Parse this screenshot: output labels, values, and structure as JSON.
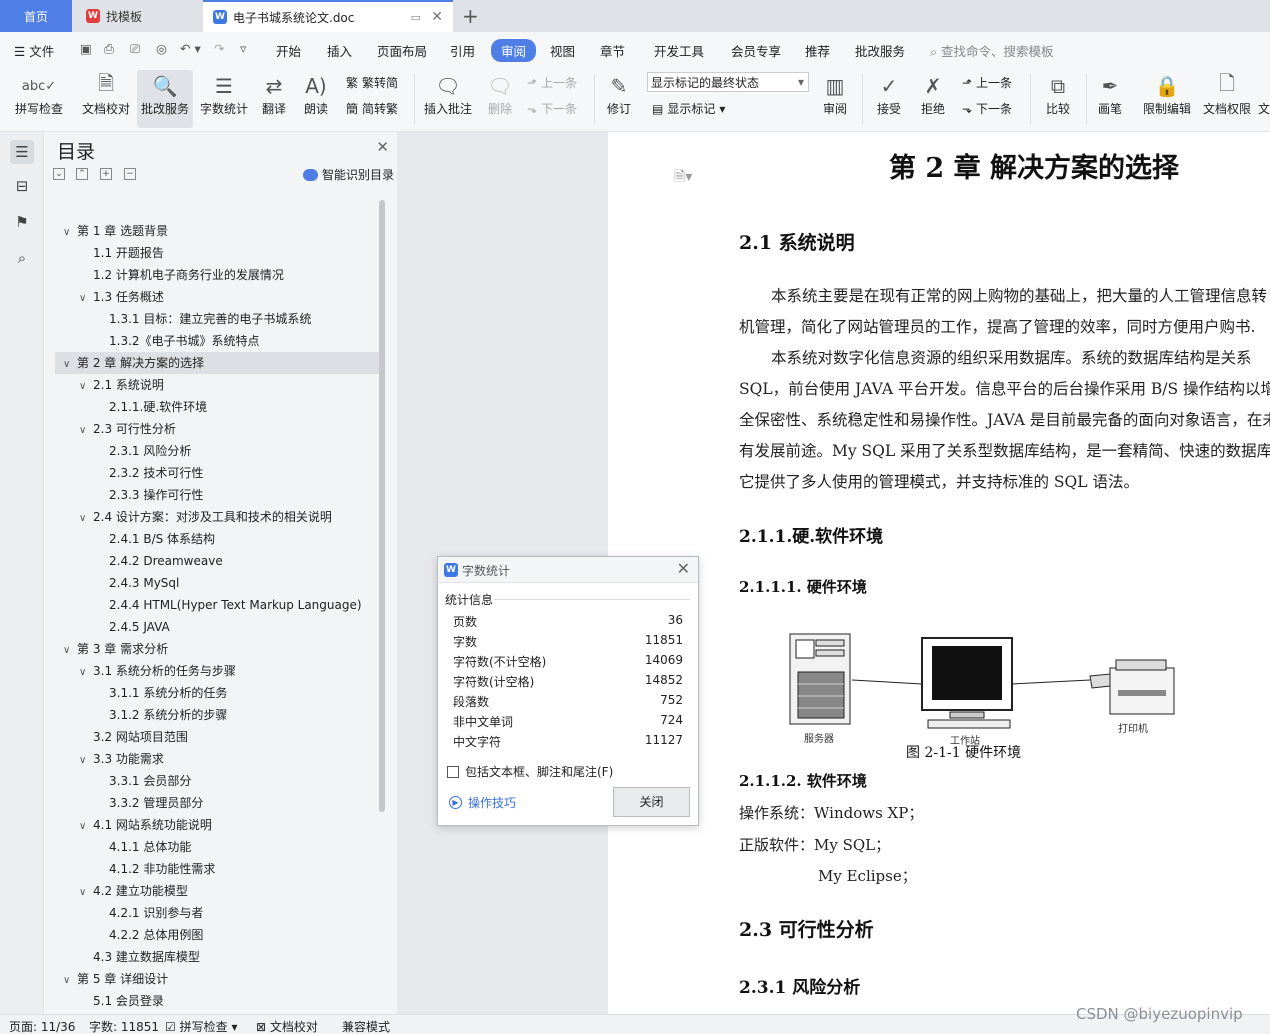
{
  "tabs": {
    "home": "首页",
    "template": "找模板",
    "document": "电子书城系统论文.doc"
  },
  "menubar": {
    "file": "文件",
    "items": [
      "开始",
      "插入",
      "页面布局",
      "引用",
      "审阅",
      "视图",
      "章节",
      "开发工具",
      "会员专享",
      "推荐",
      "批改服务"
    ],
    "active": "审阅",
    "search_placeholder": "查找命令、搜索模板"
  },
  "ribbon": {
    "spell": "拼写检查",
    "proof": "文档校对",
    "review_service": "批改服务",
    "wordcount": "字数统计",
    "translate": "翻译",
    "read": "朗读",
    "trad": "繁转简",
    "simp": "简转繁",
    "insert_comment": "插入批注",
    "delete": "删除",
    "prev": "上一条",
    "next": "下一条",
    "track": "修订",
    "markup_state": "显示标记的最终状态",
    "show_markup": "显示标记",
    "review": "审阅",
    "accept": "接受",
    "reject": "拒绝",
    "prev2": "上一条",
    "next2": "下一条",
    "compare": "比较",
    "pen": "画笔",
    "restrict": "限制编辑",
    "permission": "文档权限",
    "cut": "文"
  },
  "toc": {
    "title": "目录",
    "smart": "智能识别目录",
    "items": [
      {
        "label": "第 1 章  选题背景",
        "level": 0,
        "caret": true
      },
      {
        "label": "1.1 开题报告",
        "level": 1,
        "caret": false
      },
      {
        "label": "1.2 计算机电子商务行业的发展情况",
        "level": 1,
        "caret": false
      },
      {
        "label": "1.3  任务概述",
        "level": 1,
        "caret": true
      },
      {
        "label": "1.3.1 目标：建立完善的电子书城系统",
        "level": 2,
        "caret": false
      },
      {
        "label": "1.3.2《电子书城》系统特点",
        "level": 2,
        "caret": false
      },
      {
        "label": "第 2 章  解决方案的选择",
        "level": 0,
        "caret": true,
        "active": true
      },
      {
        "label": "2.1  系统说明",
        "level": 1,
        "caret": true
      },
      {
        "label": "2.1.1.硬.软件环境",
        "level": 2,
        "caret": false
      },
      {
        "label": "2.3 可行性分析",
        "level": 1,
        "caret": true
      },
      {
        "label": "2.3.1  风险分析",
        "level": 2,
        "caret": false
      },
      {
        "label": "2.3.2  技术可行性",
        "level": 2,
        "caret": false
      },
      {
        "label": "2.3.3  操作可行性",
        "level": 2,
        "caret": false
      },
      {
        "label": "2.4  设计方案：对涉及工具和技术的相关说明",
        "level": 1,
        "caret": true
      },
      {
        "label": "2.4.1 B/S 体系结构",
        "level": 2,
        "caret": false
      },
      {
        "label": "2.4.2 Dreamweave",
        "level": 2,
        "caret": false
      },
      {
        "label": "2.4.3 MySql",
        "level": 2,
        "caret": false
      },
      {
        "label": "2.4.4 HTML(Hyper Text Markup Language)",
        "level": 2,
        "caret": false
      },
      {
        "label": "2.4.5 JAVA",
        "level": 2,
        "caret": false
      },
      {
        "label": "第 3 章  需求分析",
        "level": 0,
        "caret": true
      },
      {
        "label": "3.1 系统分析的任务与步骤",
        "level": 1,
        "caret": true
      },
      {
        "label": "3.1.1  系统分析的任务",
        "level": 2,
        "caret": false
      },
      {
        "label": "3.1.2  系统分析的步骤",
        "level": 2,
        "caret": false
      },
      {
        "label": "3.2 网站项目范围",
        "level": 1,
        "caret": false
      },
      {
        "label": "3.3  功能需求",
        "level": 1,
        "caret": true
      },
      {
        "label": "3.3.1  会员部分",
        "level": 2,
        "caret": false
      },
      {
        "label": "3.3.2  管理员部分",
        "level": 2,
        "caret": false
      },
      {
        "label": "4.1  网站系统功能说明",
        "level": 1,
        "caret": true
      },
      {
        "label": "4.1.1 总体功能",
        "level": 2,
        "caret": false
      },
      {
        "label": "4.1.2 非功能性需求",
        "level": 2,
        "caret": false
      },
      {
        "label": "4.2  建立功能模型",
        "level": 1,
        "caret": true
      },
      {
        "label": "4.2.1 识别参与者",
        "level": 2,
        "caret": false
      },
      {
        "label": "4.2.2 总体用例图",
        "level": 2,
        "caret": false
      },
      {
        "label": "4.3  建立数据库模型",
        "level": 1,
        "caret": false
      },
      {
        "label": "第 5 章  详细设计",
        "level": 0,
        "caret": true
      },
      {
        "label": "5.1  会员登录",
        "level": 1,
        "caret": false
      }
    ]
  },
  "doc": {
    "h1": "第 2 章  解决方案的选择",
    "h2_1": "2.1  系统说明",
    "p1a": "本系统主要是在现有正常的网上购物的基础上，把大量的人工管理信息转",
    "p1b": "机管理，简化了网站管理员的工作，提高了管理的效率，同时方便用户购书.",
    "p2a": "本系统对数字化信息资源的组织采用数据库。系统的数据库结构是关系",
    "p2b": "SQL，前台使用 JAVA 平台开发。信息平台的后台操作采用 B/S 操作结构以增强",
    "p2c": "全保密性、系统稳定性和易操作性。JAVA 是目前最完备的面向对象语言，在未",
    "p2d": "有发展前途。My SQL 采用了关系型数据库结构，是一套精简、快速的数据库",
    "p2e": "它提供了多人使用的管理模式，并支持标准的 SQL 语法。",
    "h3_1": "2.1.1.硬.软件环境",
    "h4_1": "2.1.1.1.  硬件环境",
    "fig_server": "服务器",
    "fig_ws": "工作站",
    "fig_printer": "打印机",
    "fig_caption": "图 2-1-1  硬件环境",
    "h4_2": "2.1.1.2.  软件环境",
    "os": "操作系统：Windows XP；",
    "sw1": "正版软件：My SQL；",
    "sw2": "My Eclipse；",
    "h2_3": "2.3 可行性分析",
    "h3_31": "2.3.1  风险分析"
  },
  "dialog": {
    "title": "字数统计",
    "section": "统计信息",
    "rows": [
      {
        "label": "页数",
        "value": "36"
      },
      {
        "label": "字数",
        "value": "11851"
      },
      {
        "label": "字符数(不计空格)",
        "value": "14069"
      },
      {
        "label": "字符数(计空格)",
        "value": "14852"
      },
      {
        "label": "段落数",
        "value": "752"
      },
      {
        "label": "非中文单词",
        "value": "724"
      },
      {
        "label": "中文字符",
        "value": "11127"
      }
    ],
    "checkbox": "包括文本框、脚注和尾注(F)",
    "tips": "操作技巧",
    "close": "关闭"
  },
  "status": {
    "page": "页面: 11/36",
    "words": "字数: 11851",
    "spell": "拼写检查",
    "proof": "文档校对",
    "compat": "兼容模式"
  },
  "watermark": "CSDN @biyezuopinvip",
  "colors": {
    "accent": "#4e7ee6",
    "wps_red": "#e23d3d"
  }
}
